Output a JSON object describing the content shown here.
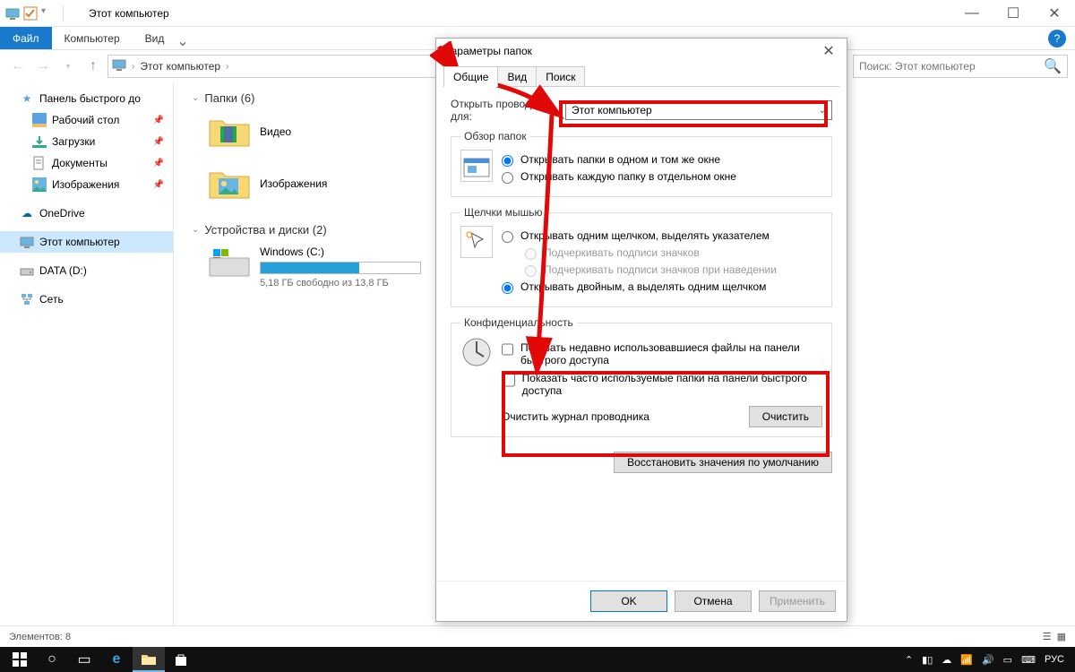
{
  "window": {
    "title": "Этот компьютер",
    "controls": {
      "minimize": "—",
      "maximize": "☐",
      "close": "✕"
    }
  },
  "ribbon": {
    "file": "Файл",
    "tabs": [
      "Компьютер",
      "Вид"
    ]
  },
  "nav": {
    "breadcrumb_root_icon": "pc",
    "crumb1": "Этот компьютер",
    "search_placeholder": "Поиск: Этот компьютер"
  },
  "sidebar": {
    "quick_access": "Панель быстрого до",
    "items": [
      {
        "icon": "desktop",
        "label": "Рабочий стол",
        "pinned": true
      },
      {
        "icon": "downloads",
        "label": "Загрузки",
        "pinned": true
      },
      {
        "icon": "documents",
        "label": "Документы",
        "pinned": true
      },
      {
        "icon": "pictures",
        "label": "Изображения",
        "pinned": true
      }
    ],
    "onedrive": "OneDrive",
    "this_pc": "Этот компьютер",
    "data_drive": "DATA (D:)",
    "network": "Сеть"
  },
  "main": {
    "folders_header": "Папки (6)",
    "folders": [
      {
        "label": "Видео"
      },
      {
        "label": "Изображения"
      }
    ],
    "drives_header": "Устройства и диски (2)",
    "drive": {
      "label": "Windows (C:)",
      "free_text": "5,18 ГБ свободно из 13,8 ГБ",
      "fill_percent": 62
    }
  },
  "statusbar": {
    "elements": "Элементов: 8"
  },
  "dialog": {
    "title": "Параметры папок",
    "tabs": {
      "general": "Общие",
      "view": "Вид",
      "search": "Поиск"
    },
    "open_explorer_for": "Открыть проводник для:",
    "dropdown_value": "Этот компьютер",
    "browse_folders": {
      "legend": "Обзор папок",
      "same_window": "Открывать папки в одном и том же окне",
      "new_window": "Открывать каждую папку в отдельном окне"
    },
    "mouse_clicks": {
      "legend": "Щелчки мышью",
      "single": "Открывать одним щелчком, выделять указателем",
      "underline_browser": "Подчеркивать подписи значков",
      "underline_hover": "Подчеркивать подписи значков при наведении",
      "double": "Открывать двойным, а выделять одним щелчком"
    },
    "privacy": {
      "legend": "Конфиденциальность",
      "recent_files": "Показать недавно использовавшиеся файлы на панели быстрого доступа",
      "frequent_folders": "Показать часто используемые папки на панели быстрого доступа",
      "clear_history": "Очистить журнал проводника",
      "clear_button": "Очистить"
    },
    "restore_defaults": "Восстановить значения по умолчанию",
    "buttons": {
      "ok": "OK",
      "cancel": "Отмена",
      "apply": "Применить"
    }
  },
  "taskbar": {
    "lang": "РУС"
  }
}
